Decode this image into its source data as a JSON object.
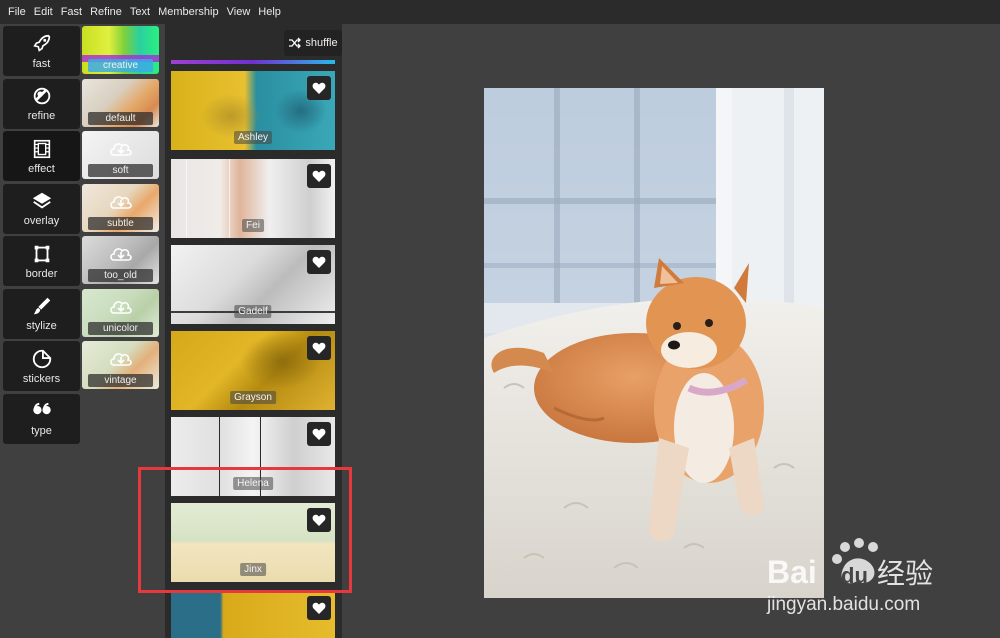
{
  "menu": [
    "File",
    "Edit",
    "Fast",
    "Refine",
    "Text",
    "Membership",
    "View",
    "Help"
  ],
  "tools": [
    {
      "label": "fast",
      "icon": "rocket-icon"
    },
    {
      "label": "refine",
      "icon": "refine-icon"
    },
    {
      "label": "effect",
      "icon": "film-icon"
    },
    {
      "label": "overlay",
      "icon": "layers-icon"
    },
    {
      "label": "border",
      "icon": "border-icon"
    },
    {
      "label": "stylize",
      "icon": "brush-icon"
    },
    {
      "label": "stickers",
      "icon": "sticker-icon"
    },
    {
      "label": "type",
      "icon": "quote-icon"
    }
  ],
  "subs": [
    "creative",
    "default",
    "soft",
    "subtle",
    "too_old",
    "unicolor",
    "vintage"
  ],
  "shuffle_label": "shuffle",
  "filters": [
    "Ashley",
    "Fei",
    "Gadelf",
    "Grayson",
    "Helena",
    "Jinx"
  ],
  "watermark": {
    "brand": "Bai",
    "brand2": "du",
    "cn": "经验",
    "url": "jingyan.baidu.com"
  },
  "colors": {
    "accent_highlight": "#e8383d",
    "active_sub": "#3caae6",
    "panel": "#2b2b2b",
    "canvas": "#404040"
  }
}
